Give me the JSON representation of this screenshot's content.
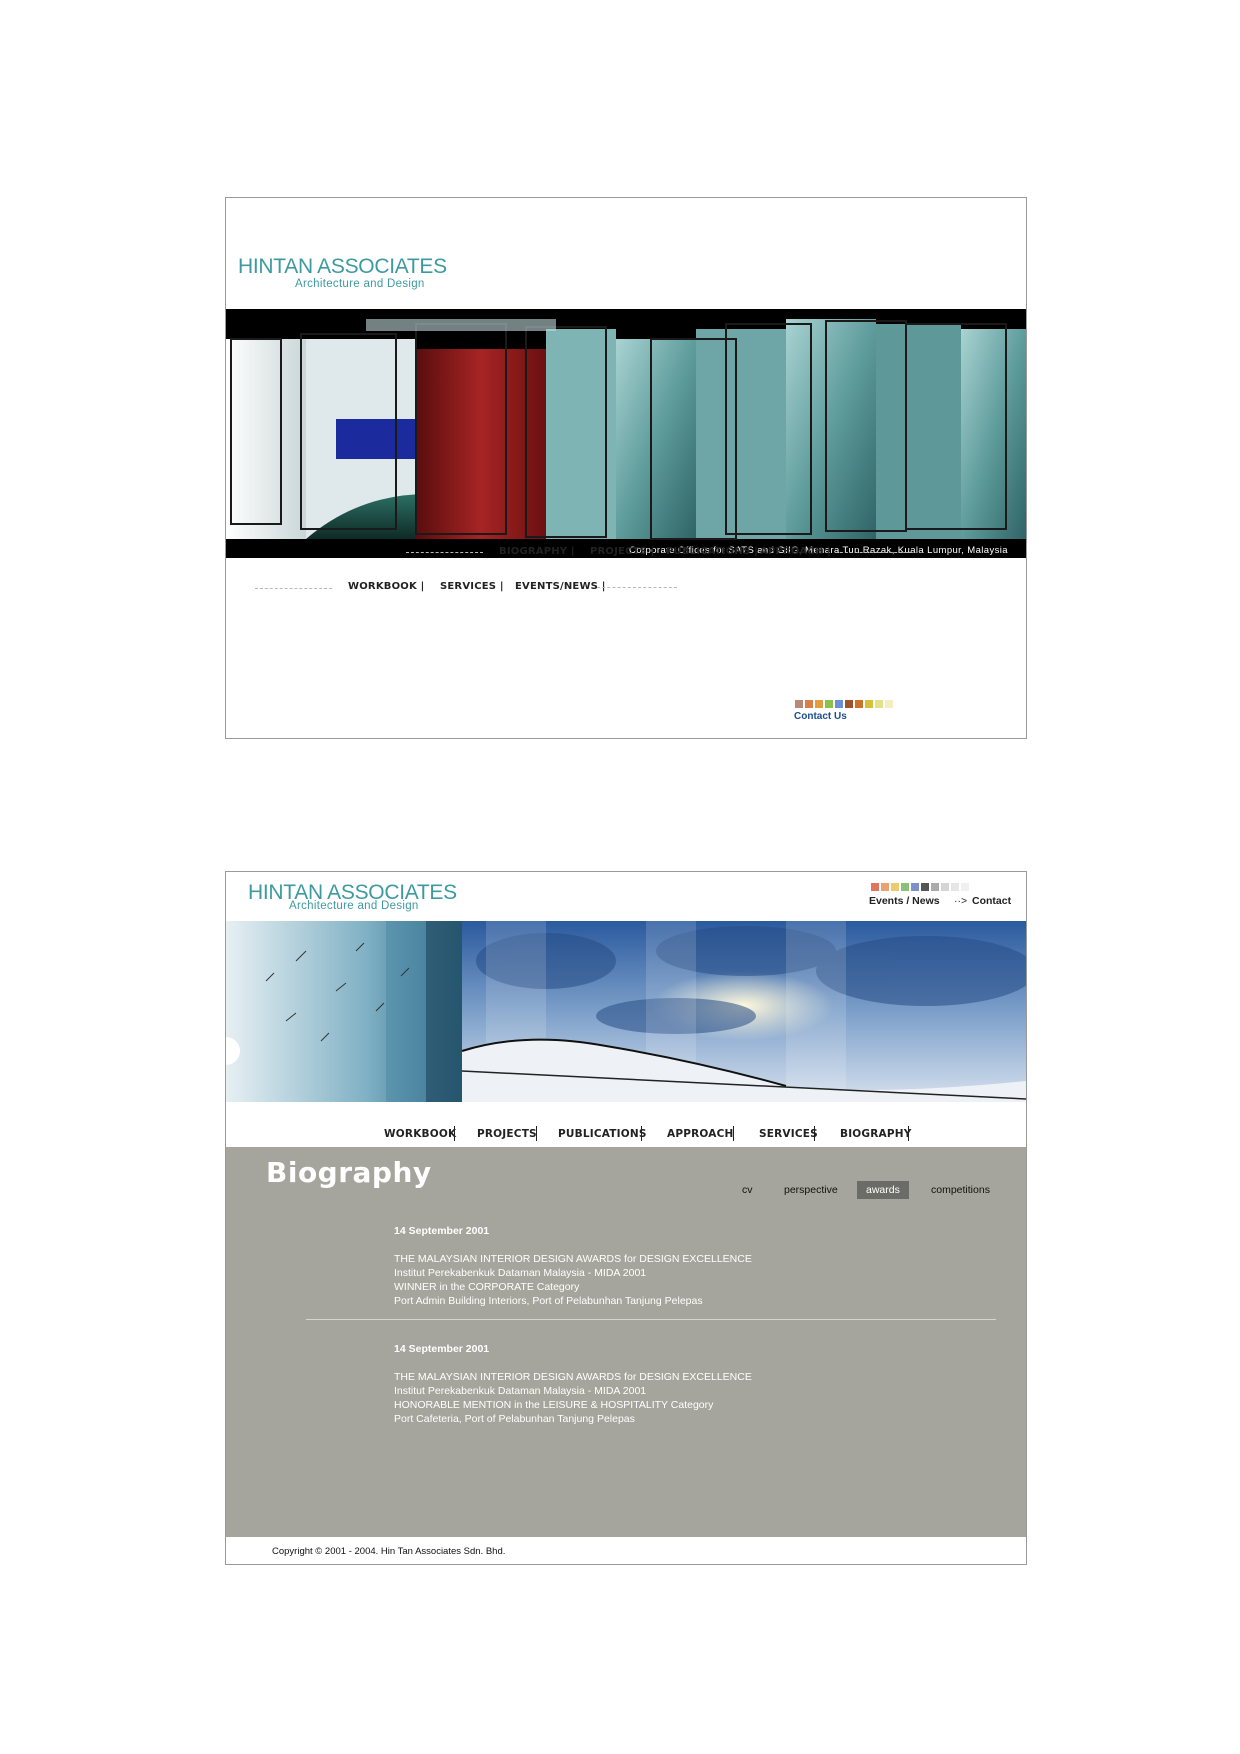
{
  "colors": {
    "brand_teal": "#3e9aa0",
    "content_gray": "#a5a59d",
    "active_tab": "#6b6b67",
    "contact_blue": "#1d4e89"
  },
  "swatch_colors": [
    "#b8897a",
    "#d9804a",
    "#e0a040",
    "#8bc34a",
    "#6a8fd6",
    "#a0522d",
    "#c8742b",
    "#d4c23a",
    "#e6e08a",
    "#f1efc2"
  ],
  "swatch_colors_2": [
    "#e2735c",
    "#eba070",
    "#eccb6a",
    "#8bc07a",
    "#7f8fc9",
    "#555555",
    "#aaaaaa",
    "#d4d4d4",
    "#e6e6e6",
    "#f0f0f0"
  ],
  "screen1": {
    "logo": {
      "title": "HINTAN ASSOCIATES",
      "subtitle": "Architecture and Design"
    },
    "hero_caption": "Corporate Offices for SATS and GIIG, Menara Tun Razak, Kuala Lumpur, Malaysia",
    "nav_row1": [
      "BIOGRAPHY |",
      "PROJECTS |",
      "PUBLICATIONS |",
      "APPROACH |"
    ],
    "nav_row2": [
      "WORKBOOK |",
      "SERVICES |",
      "EVENTS/NEWS |"
    ],
    "contact_label": "Contact Us"
  },
  "screen2": {
    "logo": {
      "title": "HINTAN ASSOCIATES",
      "subtitle": "Architecture and Design"
    },
    "top_links": {
      "events": "Events / News",
      "arrow": "··>",
      "contact": "Contact"
    },
    "nav": [
      "WORKBOOK",
      "PROJECTS",
      "PUBLICATIONS",
      "APPROACH",
      "SERVICES",
      "BIOGRAPHY"
    ],
    "page_title": "Biography",
    "subtabs": [
      "cv",
      "perspective",
      "awards",
      "competitions"
    ],
    "active_subtab": "awards",
    "entries": [
      {
        "date": "14 September 2001",
        "lines": [
          "THE MALAYSIAN INTERIOR DESIGN AWARDS for DESIGN EXCELLENCE",
          "Institut Perekabenkuk Dataman Malaysia - MIDA 2001",
          "WINNER in the CORPORATE Category",
          "Port Admin Building Interiors, Port of Pelabunhan Tanjung Pelepas"
        ]
      },
      {
        "date": "14 September 2001",
        "lines": [
          "THE MALAYSIAN INTERIOR DESIGN AWARDS for DESIGN EXCELLENCE",
          "Institut Perekabenkuk Dataman Malaysia - MIDA 2001",
          "HONORABLE MENTION in the LEISURE & HOSPITALITY Category",
          "Port Cafeteria, Port of Pelabunhan Tanjung Pelepas"
        ]
      }
    ],
    "copyright": "Copyright © 2001 - 2004. Hin Tan Associates Sdn. Bhd."
  }
}
